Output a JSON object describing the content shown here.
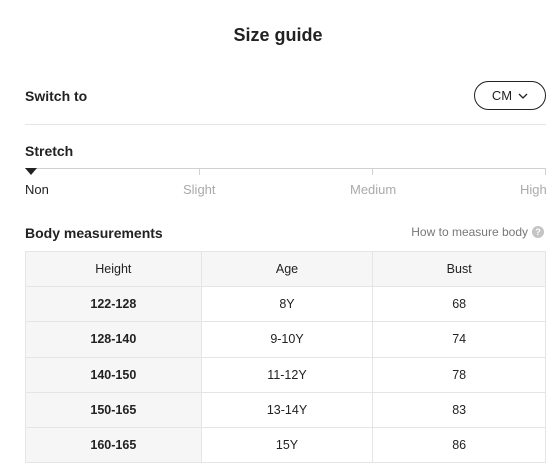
{
  "page": {
    "title": "Size guide"
  },
  "switch": {
    "label": "Switch to",
    "unit": "CM"
  },
  "stretch": {
    "title": "Stretch",
    "levels": [
      "Non",
      "Slight",
      "Medium",
      "High"
    ],
    "selected": "Non"
  },
  "body_measurements": {
    "title": "Body measurements",
    "how_to": "How to measure body",
    "help_icon": "?",
    "headers": [
      "Height",
      "Age",
      "Bust"
    ],
    "rows": [
      [
        "122-128",
        "8Y",
        "68"
      ],
      [
        "128-140",
        "9-10Y",
        "74"
      ],
      [
        "140-150",
        "11-12Y",
        "78"
      ],
      [
        "150-165",
        "13-14Y",
        "83"
      ],
      [
        "160-165",
        "15Y",
        "86"
      ]
    ]
  }
}
